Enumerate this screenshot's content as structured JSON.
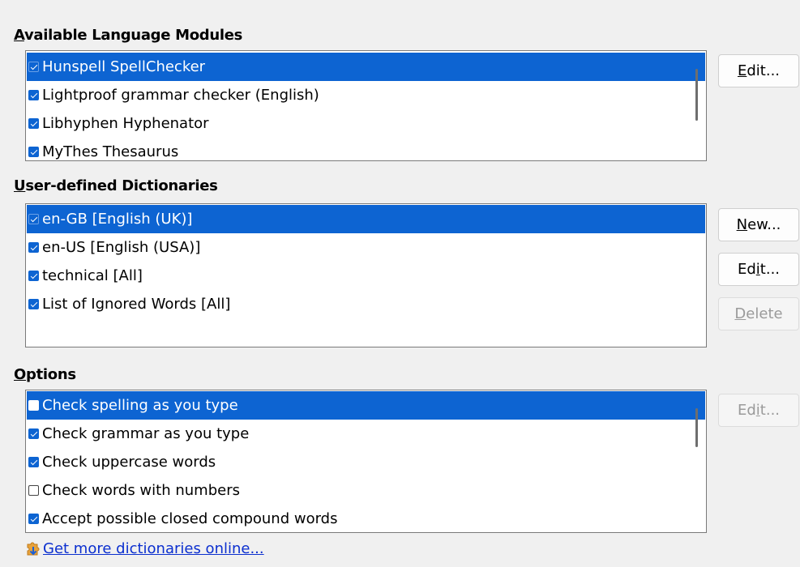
{
  "sections": {
    "modules": {
      "title_mnemonic": "A",
      "title_rest": "vailable Language Modules",
      "items": [
        {
          "label": "Hunspell SpellChecker",
          "checked": true,
          "selected": true
        },
        {
          "label": "Lightproof grammar checker (English)",
          "checked": true,
          "selected": false
        },
        {
          "label": "Libhyphen Hyphenator",
          "checked": true,
          "selected": false
        },
        {
          "label": "MyThes Thesaurus",
          "checked": true,
          "selected": false
        }
      ],
      "edit_button": {
        "pre": "",
        "mnemonic": "E",
        "post": "dit..."
      }
    },
    "dictionaries": {
      "title_mnemonic": "U",
      "title_rest": "ser-defined Dictionaries",
      "items": [
        {
          "label": "en-GB [English (UK)]",
          "checked": true,
          "selected": true
        },
        {
          "label": "en-US [English (USA)]",
          "checked": true,
          "selected": false
        },
        {
          "label": "technical [All]",
          "checked": true,
          "selected": false
        },
        {
          "label": "List of Ignored Words [All]",
          "checked": true,
          "selected": false
        }
      ],
      "new_button": {
        "pre": "",
        "mnemonic": "N",
        "post": "ew..."
      },
      "edit_button": {
        "pre": "Ed",
        "mnemonic": "i",
        "post": "t..."
      },
      "delete_button": {
        "pre": "",
        "mnemonic": "D",
        "post": "elete"
      }
    },
    "options": {
      "title_mnemonic": "O",
      "title_rest": "ptions",
      "items": [
        {
          "label": "Check spelling as you type",
          "checked": false,
          "selected": true
        },
        {
          "label": "Check grammar as you type",
          "checked": true,
          "selected": false
        },
        {
          "label": "Check uppercase words",
          "checked": true,
          "selected": false
        },
        {
          "label": "Check words with numbers",
          "checked": false,
          "selected": false
        },
        {
          "label": "Accept possible closed compound words",
          "checked": true,
          "selected": false
        }
      ],
      "edit_button": {
        "pre": "Ed",
        "mnemonic": "i",
        "post": "t..."
      }
    }
  },
  "link": {
    "text": "Get more dictionaries online...",
    "icon": "extension-download-icon"
  },
  "colors": {
    "selection": "#0d64d2",
    "link": "#0b2fcf",
    "background": "#f0f0f0"
  }
}
